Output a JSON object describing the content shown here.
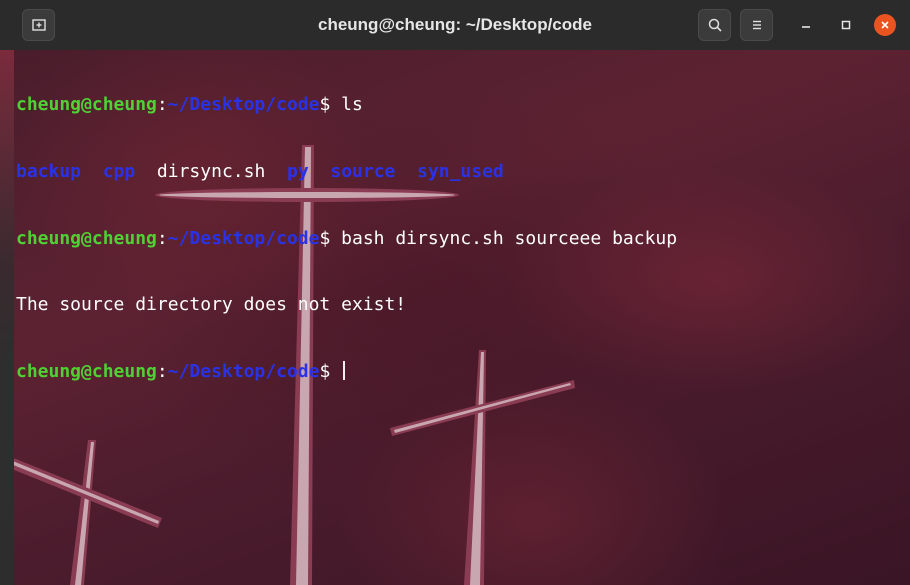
{
  "window": {
    "title": "cheung@cheung: ~/Desktop/code"
  },
  "icons": {
    "new_tab": "new-tab-icon",
    "search": "search-icon",
    "menu": "hamburger-menu-icon",
    "minimize": "minimize-icon",
    "maximize": "maximize-icon",
    "close": "close-icon"
  },
  "colors": {
    "prompt_user": "#4fd133",
    "prompt_path": "#2a32e6",
    "close_button": "#e95420",
    "terminal_bg": "#4a1d2c"
  },
  "terminal": {
    "prompt_user": "cheung@cheung",
    "prompt_colon": ":",
    "prompt_path": "~/Desktop/code",
    "prompt_symbol": "$ ",
    "command1": "ls",
    "ls_entries": [
      {
        "name": "backup",
        "type": "dir"
      },
      {
        "name": "cpp",
        "type": "dir"
      },
      {
        "name": "dirsync.sh",
        "type": "file"
      },
      {
        "name": "py",
        "type": "dir"
      },
      {
        "name": "source",
        "type": "dir"
      },
      {
        "name": "syn_used",
        "type": "dir"
      }
    ],
    "command2": "bash dirsync.sh sourceee backup",
    "output1": "The source directory does not exist!"
  }
}
